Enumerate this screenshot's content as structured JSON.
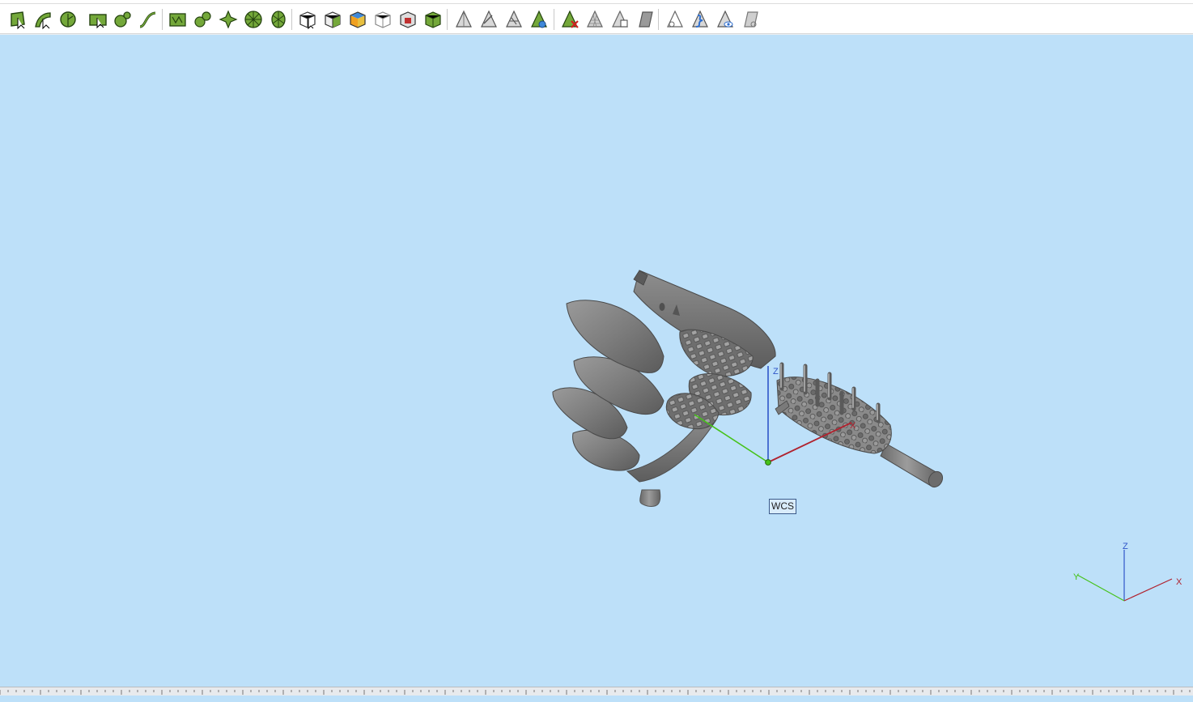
{
  "toolbar": {
    "groups": [
      {
        "name": "sketch-tools",
        "buttons": [
          {
            "id": "polyline-tool",
            "icon": "polyline-icon"
          },
          {
            "id": "arc-tool",
            "icon": "arc-icon"
          },
          {
            "id": "circle-tool",
            "icon": "circle-icon"
          },
          {
            "id": "rectangle-tool",
            "icon": "rectangle-icon"
          },
          {
            "id": "fillet-tool",
            "icon": "fillet-icon"
          },
          {
            "id": "spline-tool",
            "icon": "spline-icon"
          }
        ]
      },
      {
        "name": "pattern-tools",
        "buttons": [
          {
            "id": "linear-pattern-tool",
            "icon": "linear-pattern-icon"
          },
          {
            "id": "curve-pattern-tool",
            "icon": "curve-pattern-icon"
          },
          {
            "id": "star-pattern-tool",
            "icon": "star-pattern-icon"
          },
          {
            "id": "circular-pattern-tool",
            "icon": "circular-pattern-icon"
          },
          {
            "id": "radial-pattern-tool",
            "icon": "radial-pattern-icon"
          }
        ]
      },
      {
        "name": "solid-tools",
        "buttons": [
          {
            "id": "box-select-tool",
            "icon": "box-select-icon"
          },
          {
            "id": "box-tool",
            "icon": "box-icon"
          },
          {
            "id": "colored-box-tool",
            "icon": "colored-box-icon"
          },
          {
            "id": "wire-box-tool",
            "icon": "wire-box-icon"
          },
          {
            "id": "hollow-box-tool",
            "icon": "hollow-box-icon"
          },
          {
            "id": "green-box-tool",
            "icon": "green-box-icon"
          }
        ]
      },
      {
        "name": "surface-tools",
        "buttons": [
          {
            "id": "prism-tool",
            "icon": "prism-icon"
          },
          {
            "id": "prism-edge-tool",
            "icon": "prism-edge-icon"
          },
          {
            "id": "prism-split-tool",
            "icon": "prism-split-icon"
          },
          {
            "id": "prism-color-tool",
            "icon": "prism-color-icon"
          }
        ]
      },
      {
        "name": "repair-tools",
        "buttons": [
          {
            "id": "prism-delete-tool",
            "icon": "prism-delete-icon"
          },
          {
            "id": "prism-mesh-tool",
            "icon": "prism-mesh-icon"
          },
          {
            "id": "prism-grid-tool",
            "icon": "prism-grid-icon"
          },
          {
            "id": "prism-fill-tool",
            "icon": "prism-fill-icon"
          }
        ]
      },
      {
        "name": "view-tools",
        "buttons": [
          {
            "id": "view-wire-tool",
            "icon": "view-wire-icon"
          },
          {
            "id": "view-blue-tool",
            "icon": "view-blue-icon"
          },
          {
            "id": "view-eye-tool",
            "icon": "view-eye-icon"
          },
          {
            "id": "view-hidden-tool",
            "icon": "view-hidden-icon"
          }
        ]
      }
    ]
  },
  "viewport": {
    "background": "#bde0f9",
    "wcs_label": "WCS",
    "axes": {
      "x": "X",
      "y": "Y",
      "z": "Z"
    },
    "axis_colors": {
      "x": "#b0222e",
      "y": "#46c21a",
      "z": "#2f55c8"
    },
    "model_color": "#7d7d7d"
  }
}
